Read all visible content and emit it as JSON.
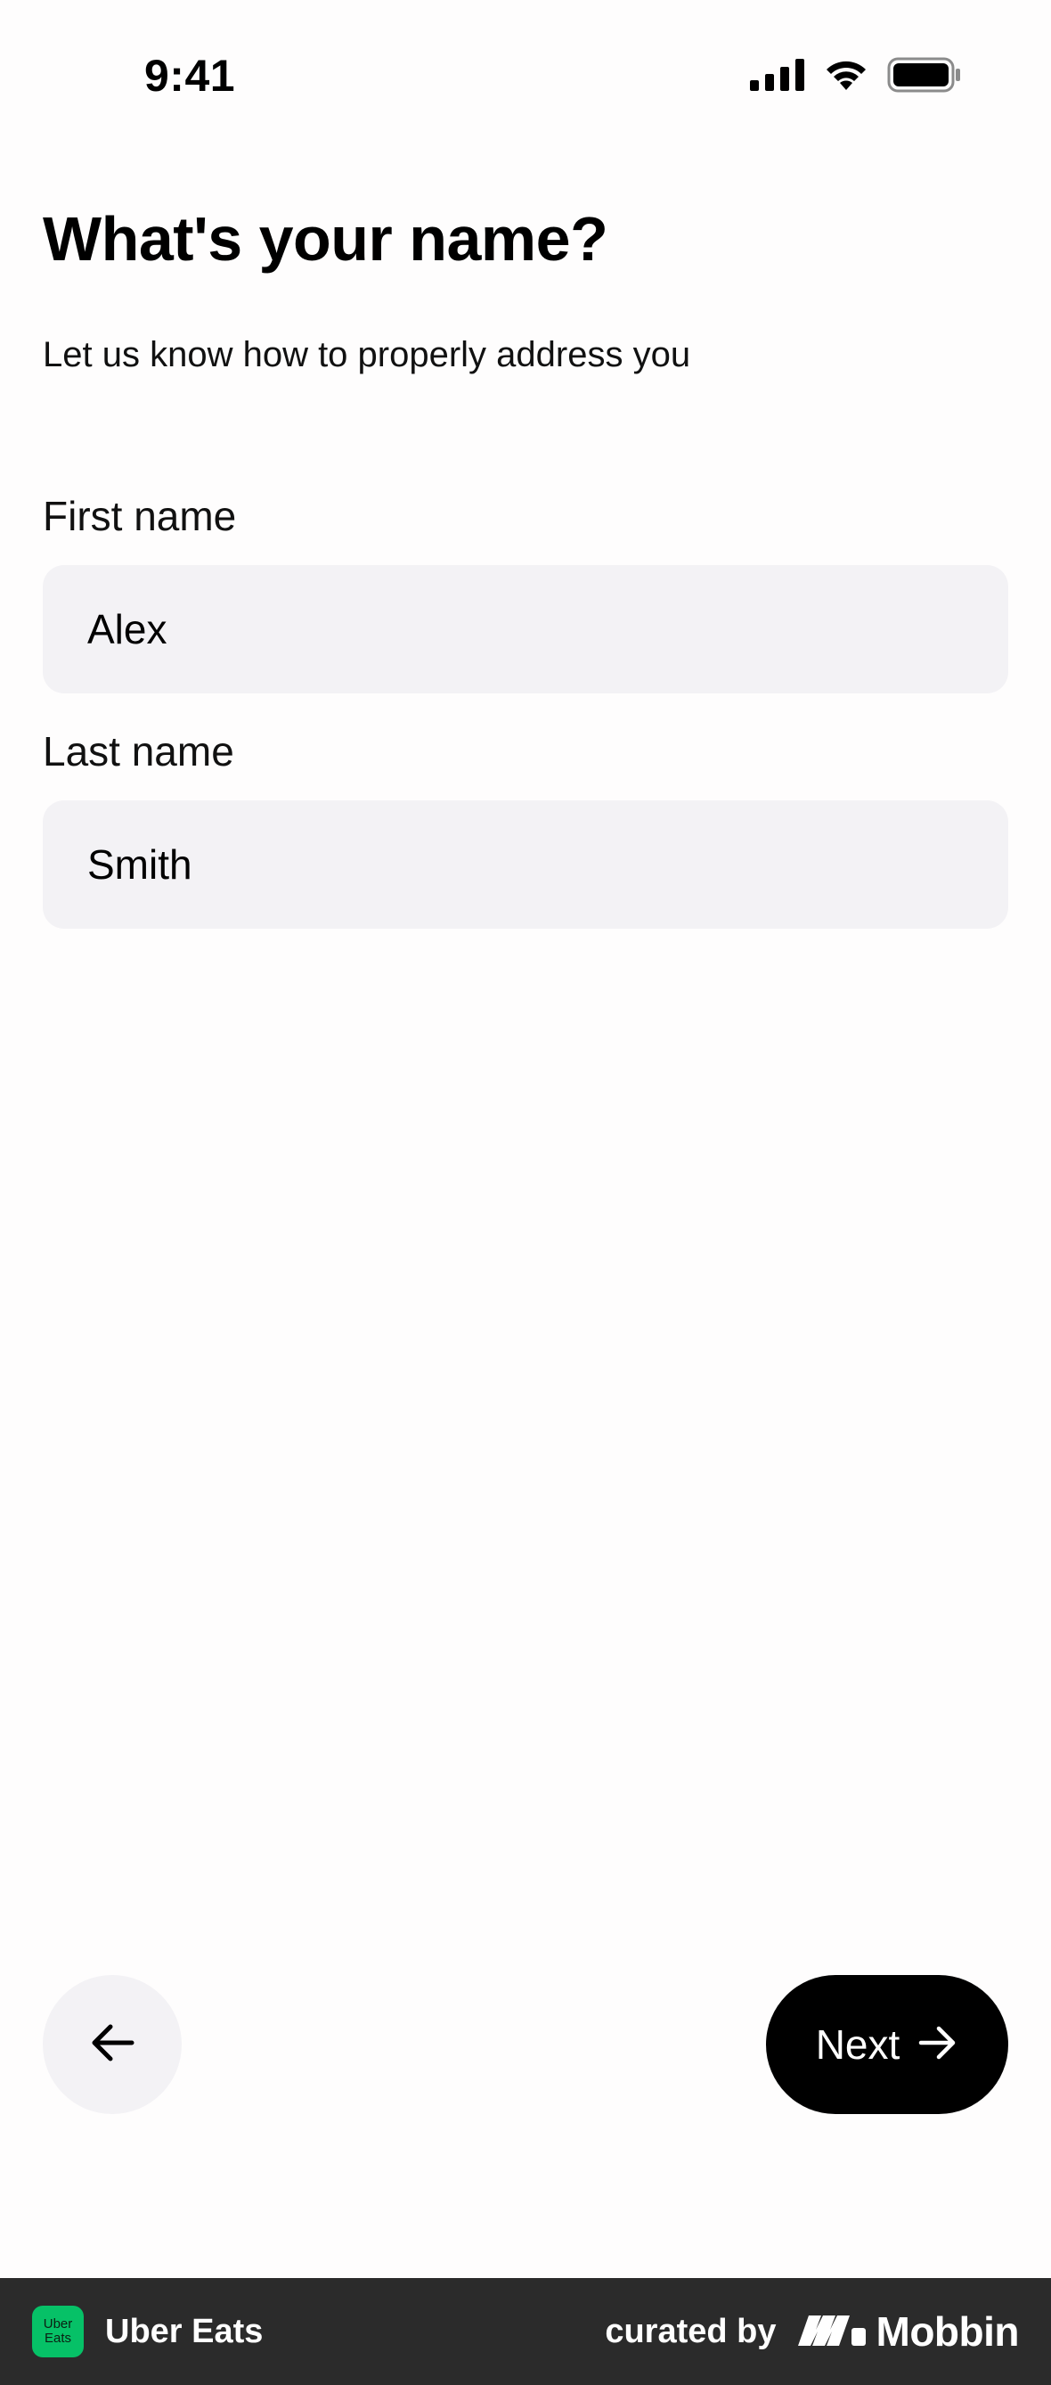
{
  "status_bar": {
    "time": "9:41",
    "icons": [
      "cellular-signal-icon",
      "wifi-icon",
      "battery-icon"
    ]
  },
  "header": {
    "title": "What's your name?",
    "subtitle": "Let us know how to properly address you"
  },
  "form": {
    "first_name": {
      "label": "First name",
      "value": "Alex"
    },
    "last_name": {
      "label": "Last name",
      "value": "Smith"
    }
  },
  "actions": {
    "back_icon": "arrow-left-icon",
    "next_label": "Next",
    "next_icon": "arrow-right-icon"
  },
  "footer": {
    "app_badge_line1": "Uber",
    "app_badge_line2": "Eats",
    "app_name": "Uber Eats",
    "curated_label": "curated by",
    "brand_name": "Mobbin",
    "colors": {
      "badge": "#06c167",
      "banner": "#2b2b2b"
    }
  }
}
